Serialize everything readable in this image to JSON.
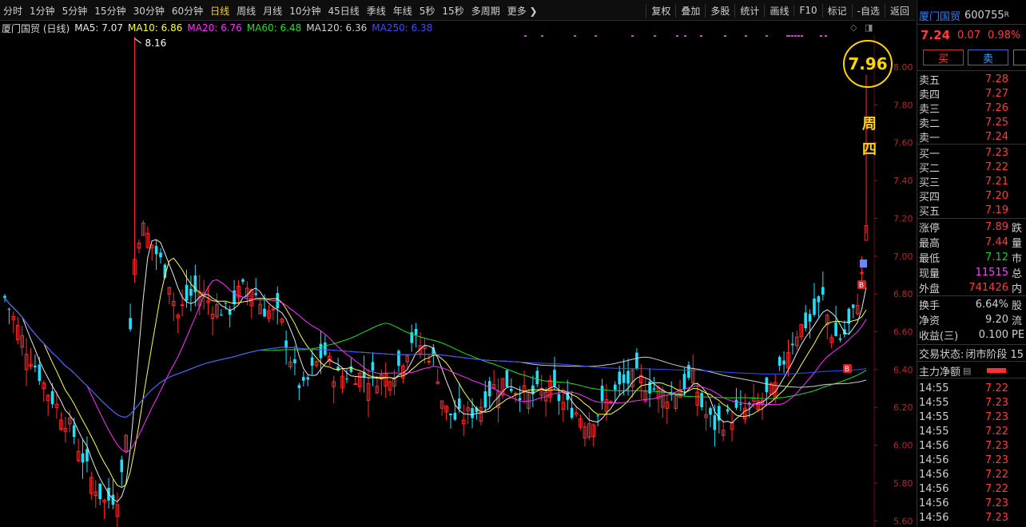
{
  "toolbar": {
    "periods": [
      "分时",
      "1分钟",
      "5分钟",
      "15分钟",
      "30分钟",
      "60分钟",
      "日线",
      "周线",
      "月线",
      "10分钟",
      "45日线",
      "季线",
      "年线",
      "5秒",
      "15秒",
      "多周期",
      "更多 ❯"
    ],
    "active_period": "日线",
    "tools": [
      "复权",
      "叠加",
      "多股",
      "统计",
      "画线",
      "F10",
      "标记",
      "-自选",
      "返回"
    ]
  },
  "chart_header": {
    "stock_period": "厦门国贸 (日线)",
    "ma": [
      {
        "label": "MA5: 7.07",
        "color": "#e8e8e8"
      },
      {
        "label": "MA10: 6.86",
        "color": "#ffff40"
      },
      {
        "label": "MA20: 6.76",
        "color": "#ff30ff"
      },
      {
        "label": "MA60: 6.48",
        "color": "#20e020"
      },
      {
        "label": "MA120: 6.36",
        "color": "#cfcfcf"
      },
      {
        "label": "MA250: 6.38",
        "color": "#3a4dff"
      }
    ],
    "icons": [
      "diamond-icon",
      "window-icon"
    ]
  },
  "chart_data": {
    "type": "candlestick",
    "y_range": [
      5.56,
      8.1
    ],
    "y_ticks": [
      "8.00",
      "7.80",
      "7.60",
      "7.40",
      "7.20",
      "7.00",
      "6.80",
      "6.60",
      "6.40",
      "6.20",
      "6.00",
      "5.80",
      "5.60"
    ],
    "y_tick_values": [
      8.0,
      7.8,
      7.6,
      7.4,
      7.2,
      7.0,
      6.8,
      6.6,
      6.4,
      6.2,
      6.0,
      5.8,
      5.6
    ],
    "max_label": "8.16",
    "annotation": {
      "price": "7.96",
      "text": "周四"
    },
    "markers": [
      {
        "type": "B"
      },
      {
        "type": "B"
      }
    ],
    "candle_count": 200
  },
  "quote": {
    "name": "厦门国贸",
    "code": "600755",
    "code_suffix": "R",
    "price": "7.24",
    "change": "0.07",
    "change_pct": "0.98%",
    "buy_label": "买",
    "sell_label": "卖",
    "sells": [
      {
        "label": "卖五",
        "price": "7.28"
      },
      {
        "label": "卖四",
        "price": "7.27"
      },
      {
        "label": "卖三",
        "price": "7.26"
      },
      {
        "label": "卖二",
        "price": "7.25"
      },
      {
        "label": "卖一",
        "price": "7.24"
      }
    ],
    "buys": [
      {
        "label": "买一",
        "price": "7.23"
      },
      {
        "label": "买二",
        "price": "7.22"
      },
      {
        "label": "买三",
        "price": "7.21"
      },
      {
        "label": "买四",
        "price": "7.20"
      },
      {
        "label": "买五",
        "price": "7.19"
      }
    ],
    "stats": [
      {
        "label": "涨停",
        "value": "7.89",
        "color": "#ff3b3b",
        "tail": "跌"
      },
      {
        "label": "最高",
        "value": "7.44",
        "color": "#ff3b3b",
        "tail": "量"
      },
      {
        "label": "最低",
        "value": "7.12",
        "color": "#18d018",
        "tail": "市"
      },
      {
        "label": "现量",
        "value": "11515",
        "color": "#ff40ff",
        "tail": "总"
      },
      {
        "label": "外盘",
        "value": "741426",
        "color": "#ff3b3b",
        "tail": "内"
      }
    ],
    "stats2": [
      {
        "label": "换手",
        "value": "6.64%",
        "tail": "股"
      },
      {
        "label": "净资",
        "value": "9.20",
        "tail": "流"
      },
      {
        "label": "收益(三)",
        "value": "0.100",
        "tail": "PE"
      }
    ],
    "trade_status_label": "交易状态:",
    "trade_status": "闭市阶段 15",
    "net_flow_label": "主力净额",
    "ticks": [
      {
        "time": "14:55",
        "price": "7.22"
      },
      {
        "time": "14:55",
        "price": "7.23"
      },
      {
        "time": "14:55",
        "price": "7.23"
      },
      {
        "time": "14:55",
        "price": "7.22"
      },
      {
        "time": "14:56",
        "price": "7.23"
      },
      {
        "time": "14:56",
        "price": "7.23"
      },
      {
        "time": "14:56",
        "price": "7.22"
      },
      {
        "time": "14:56",
        "price": "7.22"
      },
      {
        "time": "14:56",
        "price": "7.23"
      },
      {
        "time": "14:56",
        "price": "7.23"
      }
    ]
  }
}
